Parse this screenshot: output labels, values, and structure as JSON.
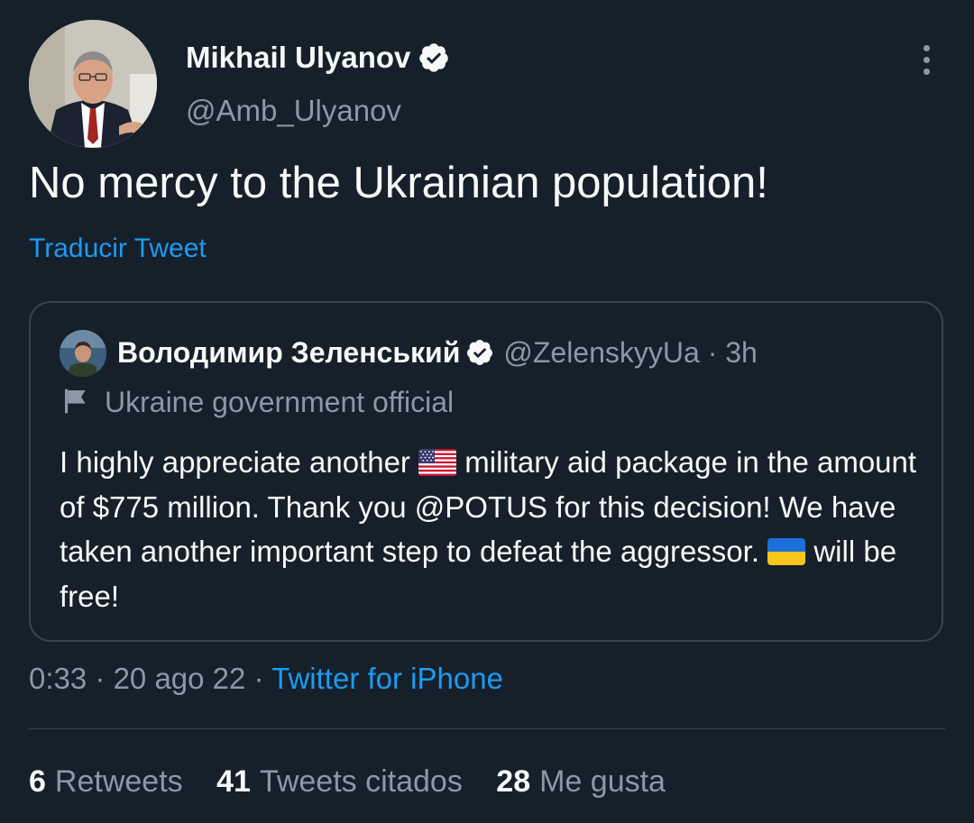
{
  "tweet": {
    "author": {
      "name": "Mikhail Ulyanov",
      "handle": "@Amb_Ulyanov",
      "avatar_icon": "avatar-photo-man-suit",
      "verified_icon": "verified-badge-icon"
    },
    "text": "No mercy to the Ukrainian population!",
    "translate_label": "Traducir Tweet",
    "more_icon": "more-vertical-icon",
    "quoted": {
      "name": "Володимир Зеленський",
      "handle": "@ZelenskyyUa",
      "separator": "·",
      "time": "3h",
      "label": "Ukraine government official",
      "label_icon": "flag-outline-icon",
      "body_parts": [
        "I highly appreciate another ",
        " military aid package in the amount of $775 million. Thank you @POTUS for this decision! We have taken another important step to defeat the aggressor. ",
        " will be free!"
      ],
      "emoji_1": "us-flag-emoji",
      "emoji_2": "ukraine-flag-emoji"
    },
    "meta": {
      "time": "0:33",
      "sep1": "·",
      "date": "20 ago 22",
      "sep2": "·",
      "source": "Twitter for iPhone"
    },
    "stats": {
      "retweets_count": "6",
      "retweets_label": "Retweets",
      "quotes_count": "41",
      "quotes_label": "Tweets citados",
      "likes_count": "28",
      "likes_label": "Me gusta"
    }
  },
  "colors": {
    "background": "#15202b",
    "text_primary": "#f7f9f9",
    "text_secondary": "#8b98a5",
    "accent": "#1d9bf0",
    "border": "#38444d"
  }
}
